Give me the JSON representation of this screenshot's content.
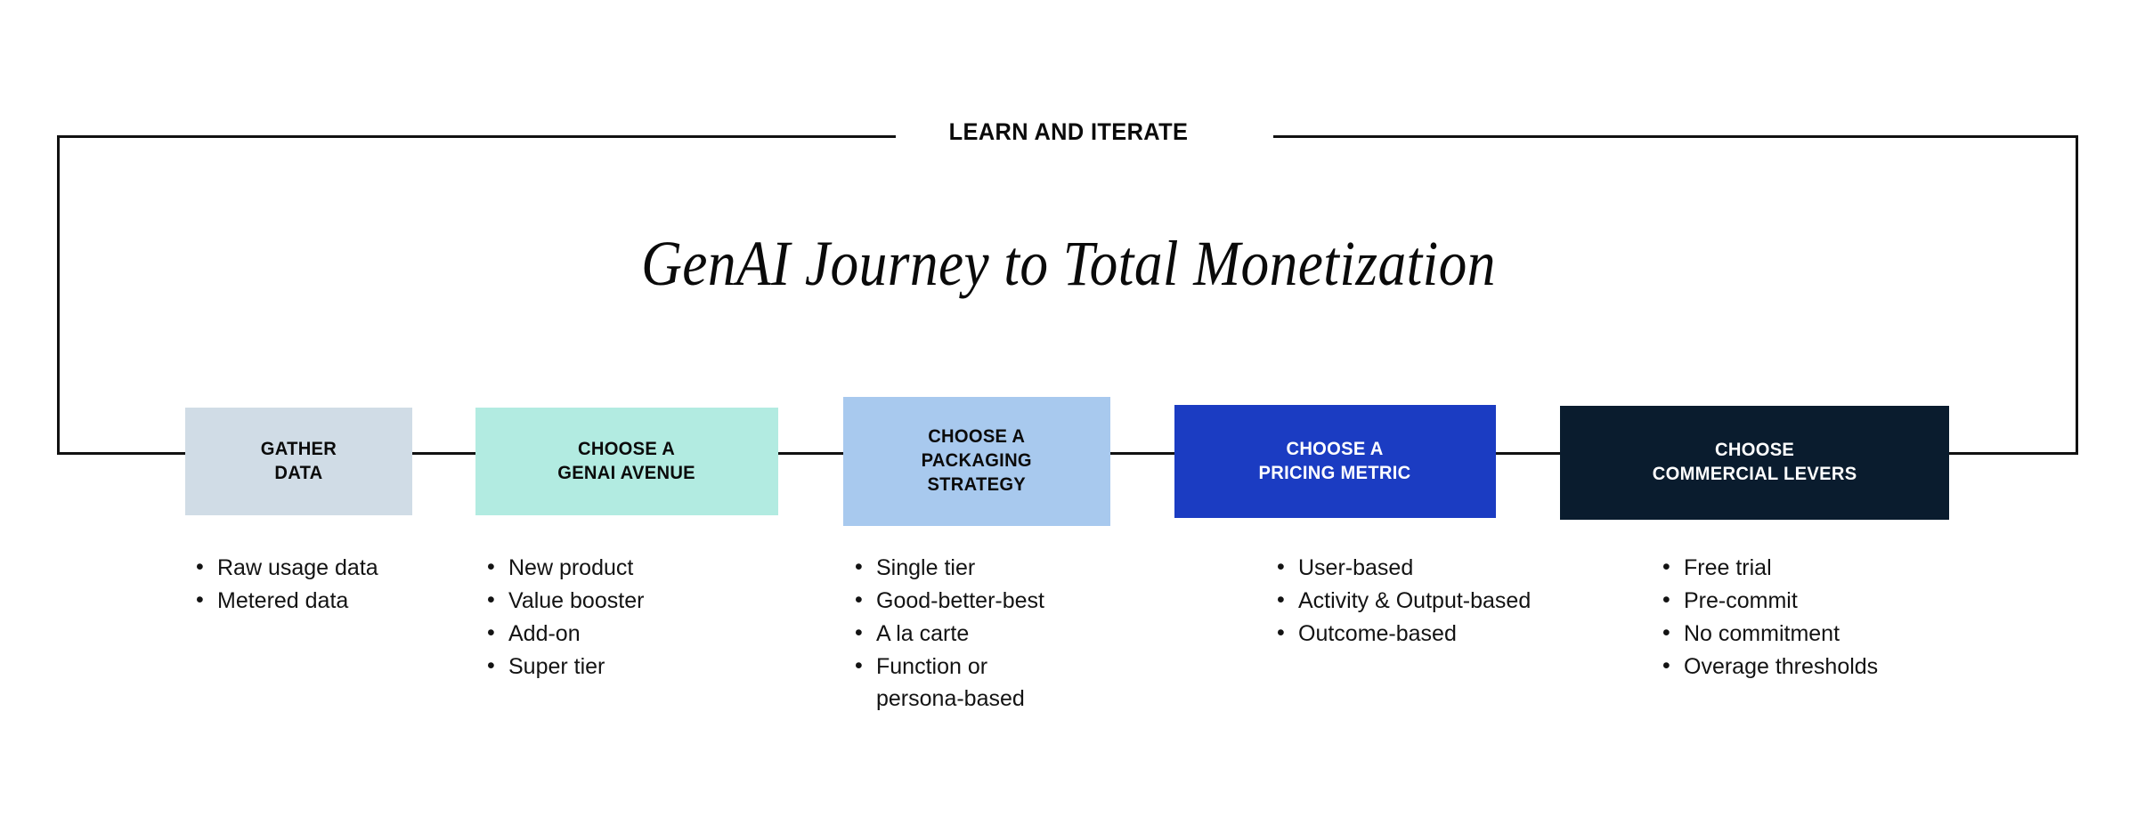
{
  "frame": {
    "title": "LEARN AND ITERATE"
  },
  "headline": "GenAI Journey to Total Monetization",
  "stages": [
    {
      "id": "gather-data",
      "label": "GATHER\nDATA",
      "box_color": "#d0dce6",
      "text_color": "#0b0b0b",
      "bullets": [
        "Raw usage data",
        "Metered data"
      ]
    },
    {
      "id": "choose-a-genai-avenue",
      "label": "CHOOSE A\nGENAI AVENUE",
      "box_color": "#b2ebe1",
      "text_color": "#0b0b0b",
      "bullets": [
        "New product",
        "Value booster",
        "Add-on",
        "Super tier"
      ]
    },
    {
      "id": "choose-a-packaging-strategy",
      "label": "CHOOSE A\nPACKAGING\nSTRATEGY",
      "box_color": "#a8c9ee",
      "text_color": "#0b0b0b",
      "bullets": [
        "Single tier",
        "Good-better-best",
        "A la carte",
        "Function or persona-based"
      ]
    },
    {
      "id": "choose-a-pricing-metric",
      "label": "CHOOSE A\nPRICING METRIC",
      "box_color": "#1b3cc2",
      "text_color": "#ffffff",
      "bullets": [
        "User-based",
        "Activity & Output-based",
        "Outcome-based"
      ]
    },
    {
      "id": "choose-commercial-levers",
      "label": "CHOOSE\nCOMMERCIAL LEVERS",
      "box_color": "#0a1c2e",
      "text_color": "#ffffff",
      "bullets": [
        "Free trial",
        "Pre-commit",
        "No commitment",
        "Overage thresholds"
      ]
    }
  ],
  "colors": {
    "line": "#111111",
    "background": "#ffffff",
    "body_text": "#131313"
  }
}
